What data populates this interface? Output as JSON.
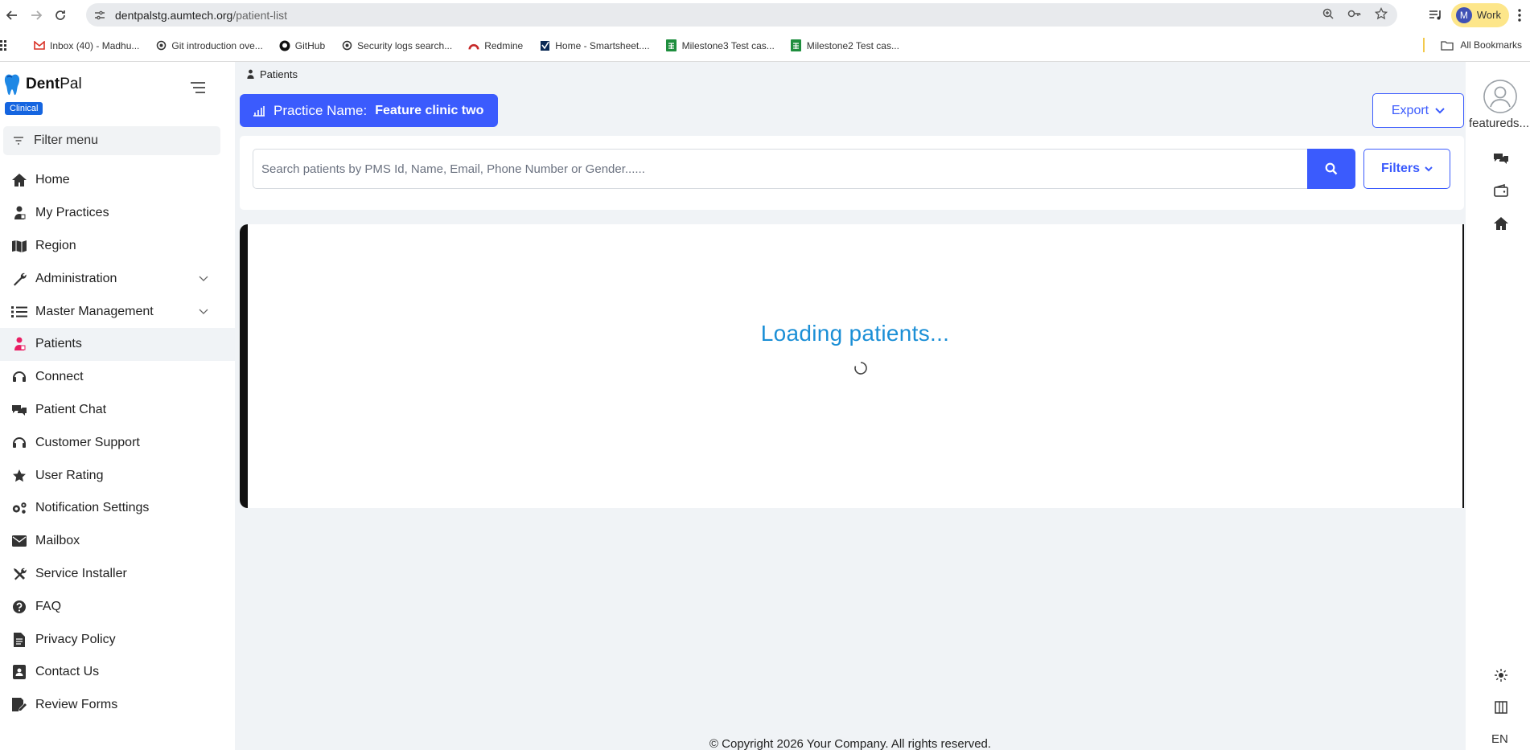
{
  "browser": {
    "url_host": "dentpalstg.aumtech.org",
    "url_path": "/patient-list",
    "profile_label": "Work",
    "profile_initial": "M",
    "bookmarks": [
      {
        "label": "Inbox (40) - Madhu...",
        "icon": "gmail-icon"
      },
      {
        "label": "Git introduction ove...",
        "icon": "openai-icon"
      },
      {
        "label": "GitHub",
        "icon": "github-icon"
      },
      {
        "label": "Security logs search...",
        "icon": "openai-icon"
      },
      {
        "label": "Redmine",
        "icon": "redmine-icon"
      },
      {
        "label": "Home - Smartsheet....",
        "icon": "smartsheet-icon"
      },
      {
        "label": "Milestone3 Test cas...",
        "icon": "sheets-icon"
      },
      {
        "label": "Milestone2 Test cas...",
        "icon": "sheets-icon"
      }
    ],
    "all_bookmarks": "All Bookmarks"
  },
  "sidebar": {
    "brand_bold": "Dent",
    "brand_rest": "Pal",
    "badge": "Clinical",
    "filter_menu": "Filter menu",
    "items": [
      {
        "label": "Home",
        "icon": "home-icon"
      },
      {
        "label": "My Practices",
        "icon": "practices-icon"
      },
      {
        "label": "Region",
        "icon": "map-icon"
      },
      {
        "label": "Administration",
        "icon": "wrench-icon"
      },
      {
        "label": "Master Management",
        "icon": "list-icon"
      },
      {
        "label": "Patients",
        "icon": "patient-icon"
      },
      {
        "label": "Connect",
        "icon": "headset-icon"
      },
      {
        "label": "Patient Chat",
        "icon": "chat-icon"
      },
      {
        "label": "Customer Support",
        "icon": "headset-icon"
      },
      {
        "label": "User Rating",
        "icon": "star-icon"
      },
      {
        "label": "Notification Settings",
        "icon": "gears-icon"
      },
      {
        "label": "Mailbox",
        "icon": "mail-icon"
      },
      {
        "label": "Service Installer",
        "icon": "tools-icon"
      },
      {
        "label": "FAQ",
        "icon": "question-icon"
      },
      {
        "label": "Privacy Policy",
        "icon": "document-icon"
      },
      {
        "label": "Contact Us",
        "icon": "contact-icon"
      },
      {
        "label": "Review Forms",
        "icon": "review-icon"
      }
    ]
  },
  "main": {
    "breadcrumb": "Patients",
    "practice_label": "Practice Name:",
    "practice_name": "Feature clinic two",
    "export_label": "Export",
    "search_placeholder": "Search patients by PMS Id, Name, Email, Phone Number or Gender......",
    "filters_label": "Filters",
    "loading_text": "Loading patients..."
  },
  "rail": {
    "user_name": "featureds...",
    "language": "EN"
  },
  "footer": "© Copyright 2026 Your Company. All rights reserved.",
  "colors": {
    "accent": "#3b5bfd",
    "loading": "#1b8fd6",
    "active_icon": "#e91e63"
  }
}
